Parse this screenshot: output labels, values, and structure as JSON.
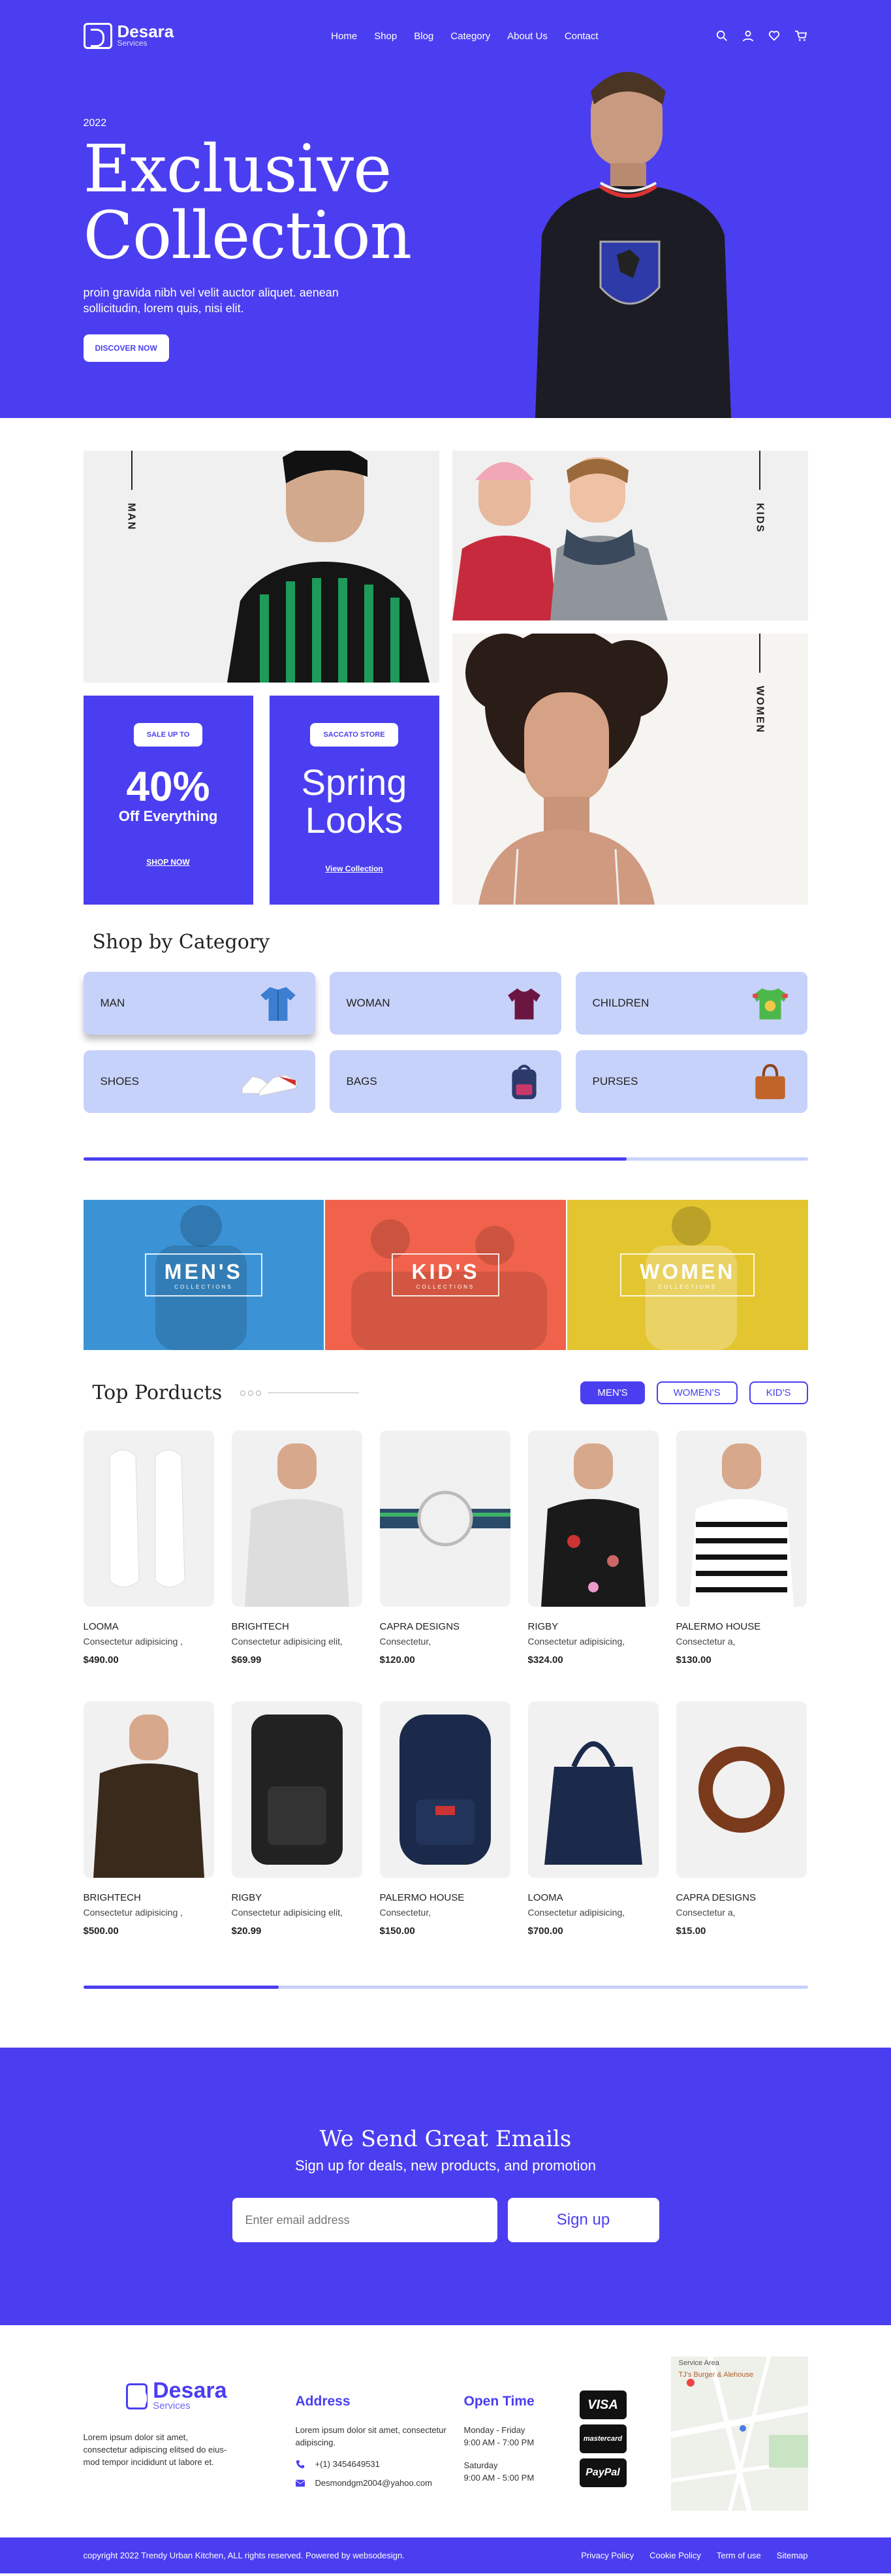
{
  "brand": {
    "name": "Desara",
    "sub": "Services"
  },
  "nav": {
    "items": [
      "Home",
      "Shop",
      "Blog",
      "Category",
      "About Us",
      "Contact"
    ]
  },
  "hero": {
    "year": "2022",
    "title_line1": "Exclusive",
    "title_line2": "Collection",
    "desc": "proin gravida nibh vel velit auctor aliquet. aenean sollicitudin, lorem quis, nisi elit.",
    "button": "DISCOVER NOW"
  },
  "collage": {
    "man": "MAN",
    "kids": "KIDS",
    "women": "WOMEN",
    "promo1": {
      "tag": "SALE UP TO",
      "big": "40%",
      "mid": "Off Everything",
      "link": "SHOP NOW"
    },
    "promo2": {
      "tag": "SACCATO STORE",
      "line1": "Spring",
      "line2": "Looks",
      "link": "View Collection"
    }
  },
  "category": {
    "title": "Shop by Category",
    "items": [
      "MAN",
      "WOMAN",
      "CHILDREN",
      "SHOES",
      "BAGS",
      "PURSES"
    ],
    "progress": 0.75
  },
  "banners": [
    {
      "title": "MEN'S",
      "sub": "COLLECTIONS",
      "color": "#3b93d6"
    },
    {
      "title": "KID'S",
      "sub": "COLLECTIONS",
      "color": "#f0624b"
    },
    {
      "title": "WOMEN",
      "sub": "COLLECTIONS",
      "color": "#e3c530"
    }
  ],
  "products": {
    "title": "Top Porducts",
    "tabs": [
      "MEN'S",
      "WOMEN'S",
      "KID'S"
    ],
    "items": [
      {
        "name": "LOOMA",
        "desc": "Consectetur adipisicing ,",
        "price": "$490.00",
        "icon": "sneakers"
      },
      {
        "name": "BRIGHTECH",
        "desc": "Consectetur adipisicing elit,",
        "price": "$69.99",
        "icon": "tshirt"
      },
      {
        "name": "CAPRA DESIGNS",
        "desc": "Consectetur,",
        "price": "$120.00",
        "icon": "watch"
      },
      {
        "name": "RIGBY",
        "desc": "Consectetur adipisicing,",
        "price": "$324.00",
        "icon": "floral-shirt"
      },
      {
        "name": "PALERMO HOUSE",
        "desc": "Consectetur a,",
        "price": "$130.00",
        "icon": "striped-shirt"
      },
      {
        "name": "BRIGHTECH",
        "desc": "Consectetur adipisicing ,",
        "price": "$500.00",
        "icon": "jacket"
      },
      {
        "name": "RIGBY",
        "desc": "Consectetur adipisicing elit,",
        "price": "$20.99",
        "icon": "backpack-black"
      },
      {
        "name": "PALERMO HOUSE",
        "desc": "Consectetur,",
        "price": "$150.00",
        "icon": "backpack-navy"
      },
      {
        "name": "LOOMA",
        "desc": "Consectetur adipisicing,",
        "price": "$700.00",
        "icon": "tote-bag"
      },
      {
        "name": "CAPRA DESIGNS",
        "desc": "Consectetur a,",
        "price": "$15.00",
        "icon": "bracelet"
      }
    ],
    "progress": 0.27
  },
  "newsletter": {
    "title": "We Send Great Emails",
    "subtitle": "Sign up for deals, new products, and promotion",
    "placeholder": "Enter email address",
    "button": "Sign up"
  },
  "footer": {
    "about": "Lorem ipsum dolor sit amet, consectetur adipiscing elitsed do eius- mod tempor incididunt ut labore et.",
    "address_title": "Address",
    "address": "Lorem ipsum dolor sit amet, consectetur adipiscing.",
    "phone": "+(1) 3454649531",
    "email": "Desmondgm2004@yahoo.com",
    "hours_title": "Open Time",
    "hours": [
      "Monday - Friday",
      "9:00 AM - 7:00 PM",
      "Saturday",
      "9:00 AM - 5:00 PM"
    ],
    "payments": [
      "VISA",
      "mastercard",
      "PayPal"
    ],
    "map_labels": [
      "Service Area",
      "TJ's Burger & Alehouse"
    ],
    "copyright": "copyright 2022 Trendy Urban Kitchen, ALL rights reserved. Powered by websodesign.",
    "links": [
      "Privacy Policy",
      "Cookie Policy",
      "Term of use",
      "Sitemap"
    ]
  }
}
